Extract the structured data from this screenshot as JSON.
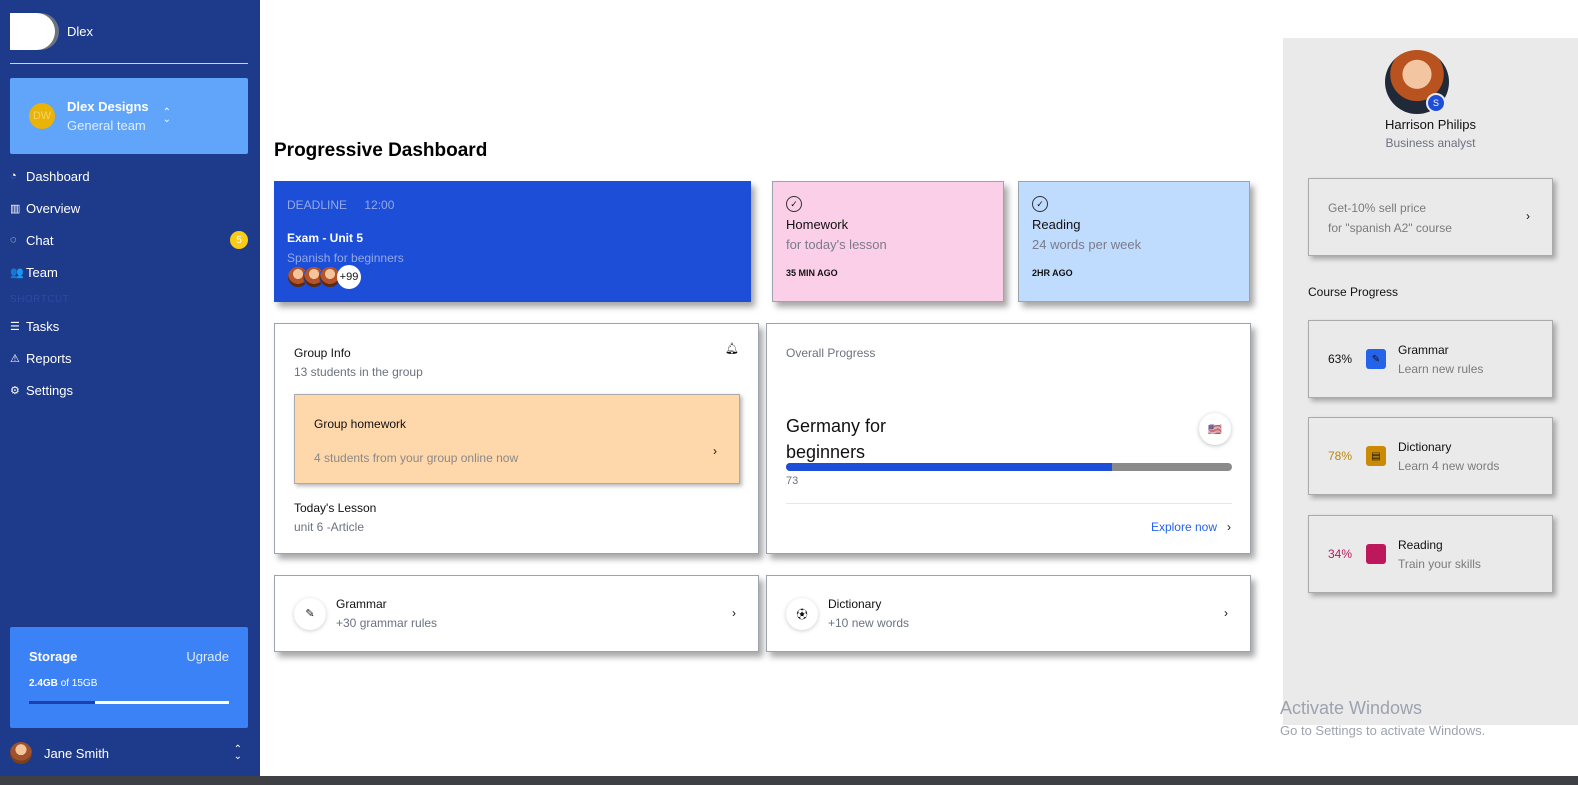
{
  "sidebar": {
    "brand": "Dlex",
    "team": {
      "avatar": "DW",
      "name": "Dlex Designs",
      "sub": "General team"
    },
    "nav": [
      {
        "label": "Dashboard",
        "icon": "pie-chart-icon"
      },
      {
        "label": "Overview",
        "icon": "bar-chart-icon"
      },
      {
        "label": "Chat",
        "icon": "chat-icon",
        "badge": "5"
      },
      {
        "label": "Team",
        "icon": "users-icon"
      }
    ],
    "section": "SHORTCUT",
    "nav2": [
      {
        "label": "Tasks",
        "icon": "list-icon"
      },
      {
        "label": "Reports",
        "icon": "warning-icon"
      },
      {
        "label": "Settings",
        "icon": "gear-icon"
      }
    ],
    "storage": {
      "title": "Storage",
      "upgrade": "Ugrade",
      "used": "2.4GB",
      "of": "of 15GB",
      "fraction": 0.33
    },
    "user": {
      "name": "Jane Smith"
    }
  },
  "main": {
    "title": "Progressive Dashboard",
    "exam": {
      "deadline_label": "DEADLINE",
      "deadline_time": "12:00",
      "title": "Exam - Unit 5",
      "sub": "Spanish for beginners",
      "more": "+99"
    },
    "homework": {
      "title": "Homework",
      "sub": "for today's lesson",
      "time": "35 MIN AGO"
    },
    "reading": {
      "title": "Reading",
      "sub": "24 words per week",
      "time": "2HR AGO"
    },
    "group": {
      "title": "Group Info",
      "sub": "13 students in the group",
      "homework_title": "Group homework",
      "homework_sub": "4 students from your group online now",
      "lesson_title": "Today's Lesson",
      "lesson_sub": "unit 6 -Article"
    },
    "progress": {
      "title": "Overall Progress",
      "course": "Germany for beginners",
      "value": "73",
      "percent": 73,
      "explore": "Explore now"
    },
    "grammar": {
      "title": "Grammar",
      "sub": "+30 grammar rules"
    },
    "dictionary": {
      "title": "Dictionary",
      "sub": "+10 new words"
    }
  },
  "right": {
    "profile": {
      "name": "Harrison Philips",
      "role": "Business analyst",
      "badge": "S"
    },
    "promo": {
      "line1": "Get-10% sell price",
      "line2": "for \"spanish A2\" course"
    },
    "course_progress_title": "Course Progress",
    "courses": [
      {
        "pct": "63%",
        "name": "Grammar",
        "sub": "Learn new rules",
        "color": "#2563eb",
        "pct_color": "#111111",
        "icon": "pencil-icon"
      },
      {
        "pct": "78%",
        "name": "Dictionary",
        "sub": "Learn 4 new words",
        "color": "#ca8a04",
        "pct_color": "#b8860b",
        "icon": "document-icon"
      },
      {
        "pct": "34%",
        "name": "Reading",
        "sub": "Train your skills",
        "color": "#be185d",
        "pct_color": "#be185d",
        "icon": "book-icon"
      }
    ]
  },
  "watermark": {
    "title": "Activate Windows",
    "sub": "Go to Settings to activate Windows."
  }
}
